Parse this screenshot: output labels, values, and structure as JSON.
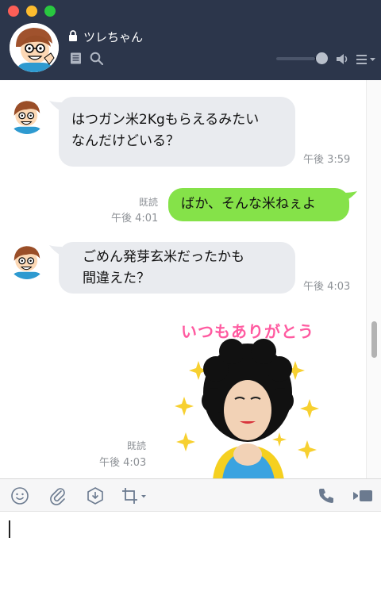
{
  "window": {
    "controls": [
      "close",
      "minimize",
      "zoom"
    ]
  },
  "header": {
    "chat_name": "ツレちゃん",
    "icons": [
      "lock-icon",
      "notes-icon",
      "search-icon",
      "speaker-icon",
      "menu-icon"
    ],
    "volume_level": 0.85,
    "colors": {
      "background": "#2c364b",
      "text": "#ffffff"
    }
  },
  "messages": [
    {
      "sender": "ツレちゃん",
      "side": "incoming",
      "lines": [
        "はつガン米2Kgもらえるみたい",
        "なんだけどいる？"
      ],
      "time": "午後 3:59"
    },
    {
      "sender": "me",
      "side": "outgoing",
      "lines": [
        "ばか、そんな米ねぇよ"
      ],
      "read": "既読",
      "time": "午後 4:01"
    },
    {
      "sender": "ツレちゃん",
      "side": "incoming",
      "lines": [
        "ごめん発芽玄米だったかも",
        "間違えた？"
      ],
      "time": "午後 4:03"
    },
    {
      "sender": "me",
      "side": "outgoing",
      "type": "sticker",
      "sticker_text": "いつもありがとう",
      "read": "既読",
      "time": "午後 4:03"
    }
  ],
  "toolbar": {
    "left_icons": [
      "emoji-icon",
      "attach-icon",
      "keep-icon",
      "crop-icon"
    ],
    "right_icons": [
      "phone-icon",
      "video-icon"
    ]
  },
  "input": {
    "value": ""
  },
  "colors": {
    "incoming_bubble": "#e9ebef",
    "outgoing_bubble": "#85e249",
    "timestamp": "#8d9196"
  }
}
